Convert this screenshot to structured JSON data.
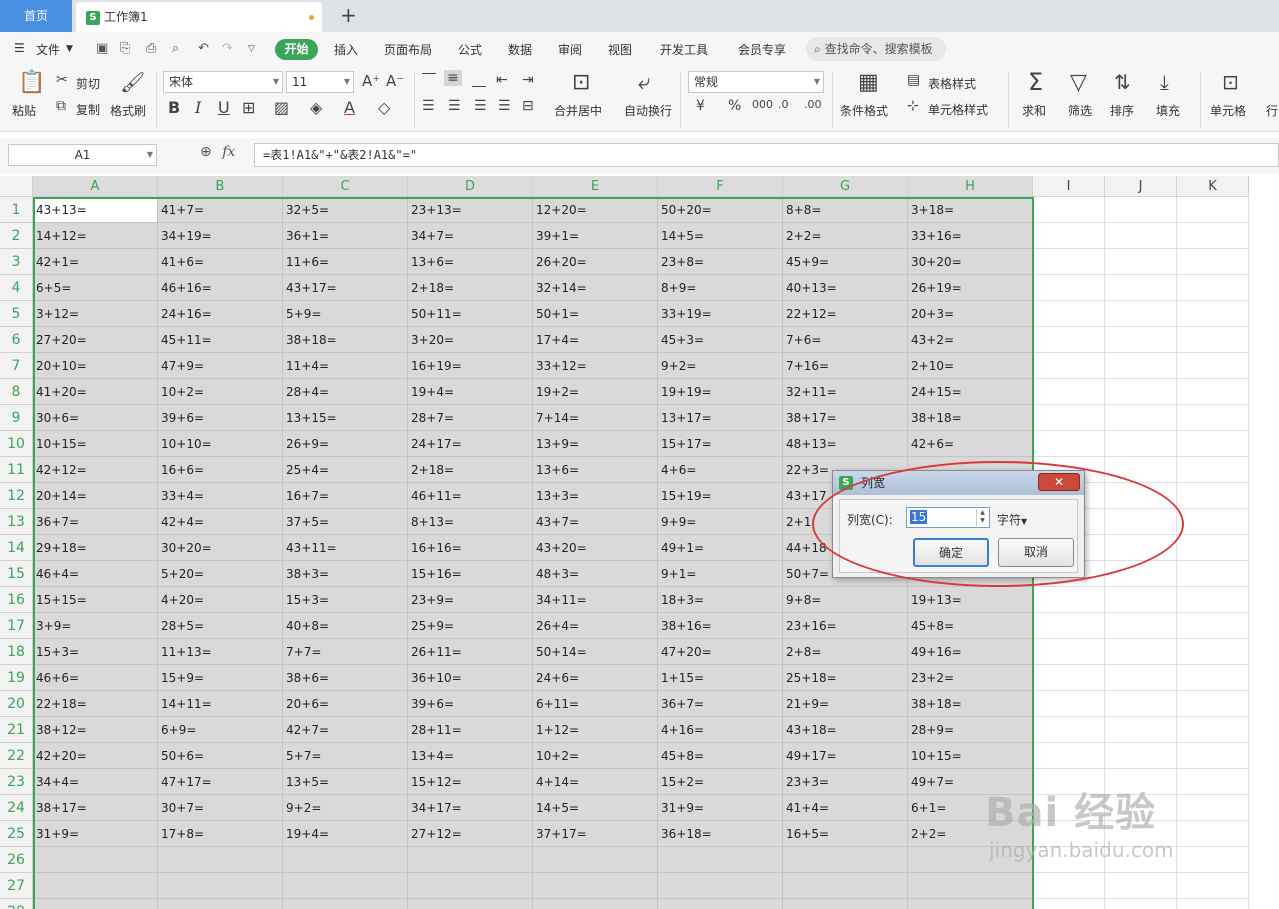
{
  "tabs": {
    "home": "首页",
    "doc": "工作簿1",
    "add": "+"
  },
  "menu": {
    "file": "文件",
    "items": [
      "开始",
      "插入",
      "页面布局",
      "公式",
      "数据",
      "审阅",
      "视图",
      "开发工具",
      "会员专享"
    ],
    "search": "查找命令、搜索模板"
  },
  "ribbon": {
    "paste": "粘贴",
    "cut": "剪切",
    "copy": "复制",
    "format_painter": "格式刷",
    "font_name": "宋体",
    "font_size": "11",
    "merge_center": "合并居中",
    "wrap_text": "自动换行",
    "number_format": "常规",
    "conditional_format": "条件格式",
    "table_style": "表格样式",
    "cell_style": "单元格样式",
    "sum": "求和",
    "filter": "筛选",
    "sort": "排序",
    "fill": "填充",
    "cell": "单元格",
    "row_col": "行"
  },
  "formula_bar": {
    "cell_ref": "A1",
    "fx": "fx",
    "formula": "=表1!A1&\"+\"&表2!A1&\"=\""
  },
  "columns": [
    "A",
    "B",
    "C",
    "D",
    "E",
    "F",
    "G",
    "H",
    "I",
    "J",
    "K"
  ],
  "rows": [
    [
      "43+13=",
      "41+7=",
      "32+5=",
      "23+13=",
      "12+20=",
      "50+20=",
      "8+8=",
      "3+18="
    ],
    [
      "14+12=",
      "34+19=",
      "36+1=",
      "34+7=",
      "39+1=",
      "14+5=",
      "2+2=",
      "33+16="
    ],
    [
      "42+1=",
      "41+6=",
      "11+6=",
      "13+6=",
      "26+20=",
      "23+8=",
      "45+9=",
      "30+20="
    ],
    [
      "6+5=",
      "46+16=",
      "43+17=",
      "2+18=",
      "32+14=",
      "8+9=",
      "40+13=",
      "26+19="
    ],
    [
      "3+12=",
      "24+16=",
      "5+9=",
      "50+11=",
      "50+1=",
      "33+19=",
      "22+12=",
      "20+3="
    ],
    [
      "27+20=",
      "45+11=",
      "38+18=",
      "3+20=",
      "17+4=",
      "45+3=",
      "7+6=",
      "43+2="
    ],
    [
      "20+10=",
      "47+9=",
      "11+4=",
      "16+19=",
      "33+12=",
      "9+2=",
      "7+16=",
      "2+10="
    ],
    [
      "41+20=",
      "10+2=",
      "28+4=",
      "19+4=",
      "19+2=",
      "19+19=",
      "32+11=",
      "24+15="
    ],
    [
      "30+6=",
      "39+6=",
      "13+15=",
      "28+7=",
      "7+14=",
      "13+17=",
      "38+17=",
      "38+18="
    ],
    [
      "10+15=",
      "10+10=",
      "26+9=",
      "24+17=",
      "13+9=",
      "15+17=",
      "48+13=",
      "42+6="
    ],
    [
      "42+12=",
      "16+6=",
      "25+4=",
      "2+18=",
      "13+6=",
      "4+6=",
      "22+3=",
      ""
    ],
    [
      "20+14=",
      "33+4=",
      "16+7=",
      "46+11=",
      "13+3=",
      "15+19=",
      "43+17",
      ""
    ],
    [
      "36+7=",
      "42+4=",
      "37+5=",
      "8+13=",
      "43+7=",
      "9+9=",
      "2+1",
      ""
    ],
    [
      "29+18=",
      "30+20=",
      "43+11=",
      "16+16=",
      "43+20=",
      "49+1=",
      "44+18",
      ""
    ],
    [
      "46+4=",
      "5+20=",
      "38+3=",
      "15+16=",
      "48+3=",
      "9+1=",
      "50+7=",
      ""
    ],
    [
      "15+15=",
      "4+20=",
      "15+3=",
      "23+9=",
      "34+11=",
      "18+3=",
      "9+8=",
      "19+13="
    ],
    [
      "3+9=",
      "28+5=",
      "40+8=",
      "25+9=",
      "26+4=",
      "38+16=",
      "23+16=",
      "45+8="
    ],
    [
      "15+3=",
      "11+13=",
      "7+7=",
      "26+11=",
      "50+14=",
      "47+20=",
      "2+8=",
      "49+16="
    ],
    [
      "46+6=",
      "15+9=",
      "38+6=",
      "36+10=",
      "24+6=",
      "1+15=",
      "25+18=",
      "23+2="
    ],
    [
      "22+18=",
      "14+11=",
      "20+6=",
      "39+6=",
      "6+11=",
      "36+7=",
      "21+9=",
      "38+18="
    ],
    [
      "38+12=",
      "6+9=",
      "42+7=",
      "28+11=",
      "1+12=",
      "4+16=",
      "43+18=",
      "28+9="
    ],
    [
      "42+20=",
      "50+6=",
      "5+7=",
      "13+4=",
      "10+2=",
      "45+8=",
      "49+17=",
      "10+15="
    ],
    [
      "34+4=",
      "47+17=",
      "13+5=",
      "15+12=",
      "4+14=",
      "15+2=",
      "23+3=",
      "49+7="
    ],
    [
      "38+17=",
      "30+7=",
      "9+2=",
      "34+17=",
      "14+5=",
      "31+9=",
      "41+4=",
      "6+1="
    ],
    [
      "31+9=",
      "17+8=",
      "19+4=",
      "27+12=",
      "37+17=",
      "36+18=",
      "16+5=",
      "2+2="
    ],
    [
      "",
      "",
      "",
      "",
      "",
      "",
      "",
      ""
    ],
    [
      "",
      "",
      "",
      "",
      "",
      "",
      "",
      ""
    ],
    [
      "",
      "",
      "",
      "",
      "",
      "",
      "",
      ""
    ]
  ],
  "dialog": {
    "title": "列宽",
    "close": "✕",
    "label": "列宽(C):",
    "value": "15",
    "unit": "字符",
    "ok": "确定",
    "cancel": "取消"
  },
  "watermark": {
    "brand": "Bai 经验",
    "url": "jingyan.baidu.com"
  }
}
